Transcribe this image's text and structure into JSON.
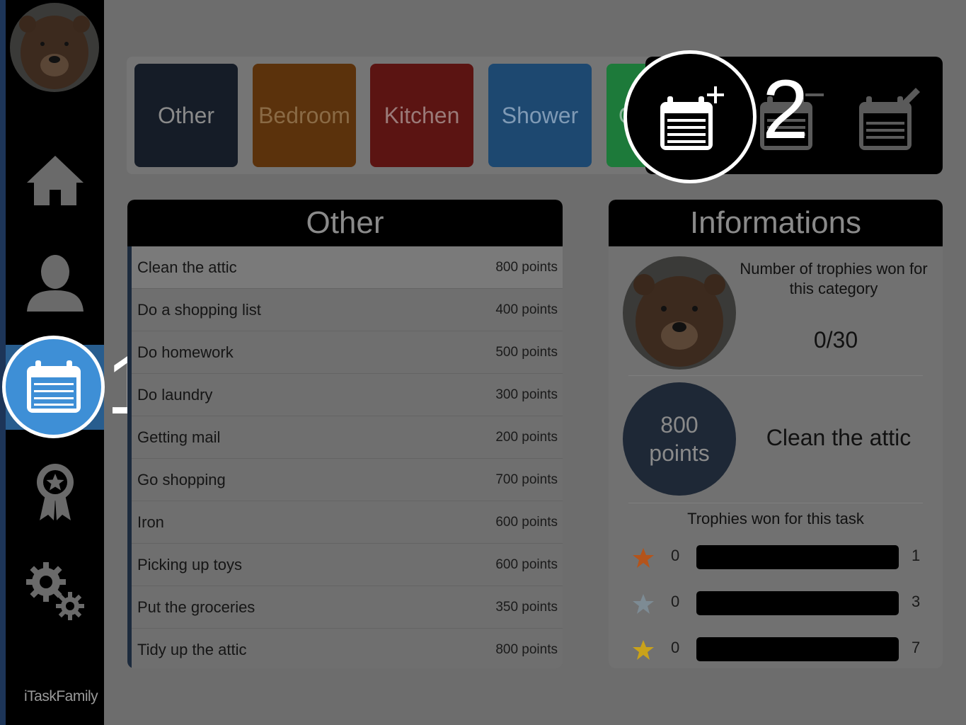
{
  "sidebar": {
    "items": [
      {
        "name": "home",
        "icon": "home-icon"
      },
      {
        "name": "profile",
        "icon": "person-icon"
      },
      {
        "name": "tasks",
        "icon": "calendar-icon",
        "active": true
      },
      {
        "name": "trophies",
        "icon": "award-ribbon-icon"
      },
      {
        "name": "settings",
        "icon": "gears-icon"
      }
    ],
    "brand": "iTaskFamily"
  },
  "callouts": {
    "first": "1",
    "second": "2"
  },
  "categories": [
    {
      "label": "Other",
      "color": "#151c27"
    },
    {
      "label": "Bedroom",
      "color": "#5b320c"
    },
    {
      "label": "Kitchen",
      "color": "#5b1412"
    },
    {
      "label": "Shower",
      "color": "#1d4870"
    },
    {
      "label": "Ou",
      "color": "#1d7a3a"
    }
  ],
  "actions": [
    {
      "name": "add-task",
      "icon": "calendar-add-icon"
    },
    {
      "name": "remove-task",
      "icon": "calendar-remove-icon"
    },
    {
      "name": "edit-task",
      "icon": "calendar-edit-icon"
    }
  ],
  "task_panel": {
    "title": "Other",
    "tasks": [
      {
        "name": "Clean the attic",
        "points": "800 points",
        "selected": true
      },
      {
        "name": "Do a shopping list",
        "points": "400 points"
      },
      {
        "name": "Do homework",
        "points": "500 points"
      },
      {
        "name": "Do laundry",
        "points": "300 points"
      },
      {
        "name": "Getting mail",
        "points": "200 points"
      },
      {
        "name": "Go shopping",
        "points": "700 points"
      },
      {
        "name": "Iron",
        "points": "600 points"
      },
      {
        "name": "Picking up toys",
        "points": "600 points"
      },
      {
        "name": "Put the groceries",
        "points": "350 points"
      },
      {
        "name": "Tidy up the attic",
        "points": "800 points"
      }
    ]
  },
  "info_panel": {
    "title": "Informations",
    "trophies_category_label": "Number of trophies won for this category",
    "trophies_category_count": "0/30",
    "points_value": "800",
    "points_unit": "points",
    "selected_task": "Clean the attic",
    "trophies_task_label": "Trophies won for this task",
    "trophies": [
      {
        "tier": "bronze",
        "color": "#b4541b",
        "won": "0",
        "target": "1",
        "progress": 0
      },
      {
        "tier": "silver",
        "color": "#7d8b94",
        "won": "0",
        "target": "3",
        "progress": 0
      },
      {
        "tier": "gold",
        "color": "#c9a21a",
        "won": "0",
        "target": "7",
        "progress": 0
      }
    ]
  }
}
